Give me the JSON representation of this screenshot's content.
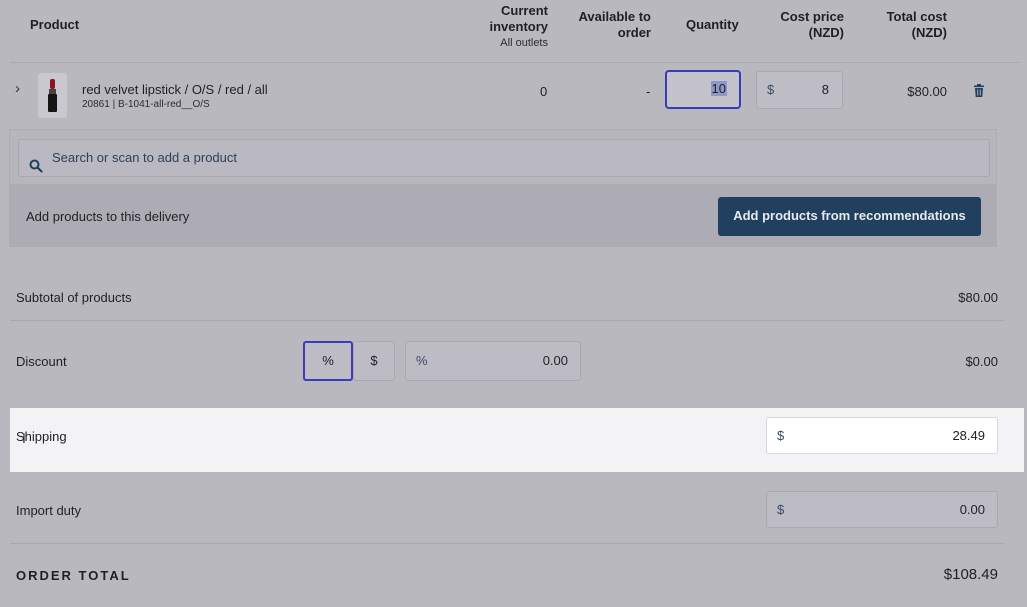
{
  "table": {
    "headers": {
      "product": "Product",
      "inventory_line1": "Current",
      "inventory_line2": "inventory",
      "inventory_sub": "All outlets",
      "available_line1": "Available to",
      "available_line2": "order",
      "quantity": "Quantity",
      "cost_line1": "Cost price",
      "cost_line2": "(NZD)",
      "total_line1": "Total cost",
      "total_line2": "(NZD)"
    },
    "row": {
      "name": "red velvet lipstick / O/S / red / all",
      "sku": "20861 | B-1041-all-red__O/S",
      "inventory": "0",
      "available": "-",
      "quantity": "10",
      "cost_prefix": "$",
      "cost": "8",
      "total": "$80.00"
    }
  },
  "search": {
    "placeholder": "Search or scan to add a product"
  },
  "add_products": {
    "label": "Add products to this delivery",
    "button": "Add products from recommendations"
  },
  "totals": {
    "subtotal_label": "Subtotal of products",
    "subtotal_value": "$80.00",
    "discount_label": "Discount",
    "discount_percent_toggle": "%",
    "discount_dollar_toggle": "$",
    "discount_prefix": "%",
    "discount_input": "0.00",
    "discount_value": "$0.00",
    "shipping_label": "Shipping",
    "shipping_prefix": "$",
    "shipping_input": "28.49",
    "import_duty_label": "Import duty",
    "import_duty_prefix": "$",
    "import_duty_input": "0.00",
    "order_total_label": "ORDER TOTAL",
    "order_total_value": "$108.49"
  },
  "colors": {
    "overlay_gray": "#b9b8bf",
    "primary_button": "#21405f",
    "focus_border": "#3d3ab8",
    "highlight_band": "#f3f3f5"
  }
}
